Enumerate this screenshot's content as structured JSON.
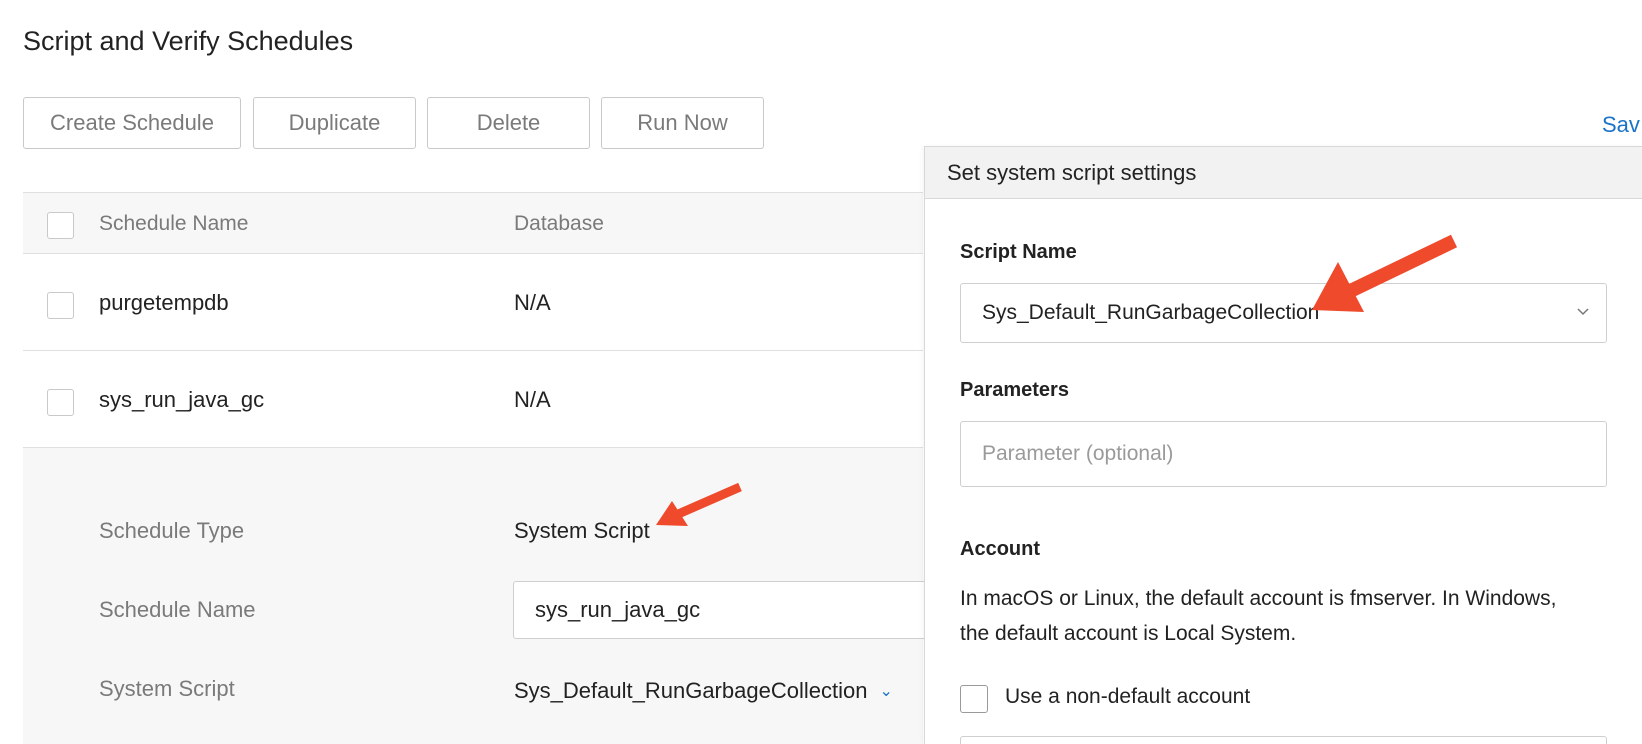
{
  "page": {
    "title": "Script and Verify Schedules"
  },
  "toolbar": {
    "create_label": "Create Schedule",
    "duplicate_label": "Duplicate",
    "delete_label": "Delete",
    "run_now_label": "Run Now",
    "save_label": "Sav"
  },
  "table": {
    "headers": {
      "name": "Schedule Name",
      "database": "Database"
    },
    "rows": [
      {
        "name": "purgetempdb",
        "database": "N/A"
      },
      {
        "name": "sys_run_java_gc",
        "database": "N/A"
      }
    ]
  },
  "details": {
    "type_label": "Schedule Type",
    "type_value": "System Script",
    "name_label": "Schedule Name",
    "name_value": "sys_run_java_gc",
    "script_label": "System Script",
    "script_value": "Sys_Default_RunGarbageCollection"
  },
  "panel": {
    "title": "Set system script settings",
    "script_name_label": "Script Name",
    "script_name_value": "Sys_Default_RunGarbageCollection",
    "parameters_label": "Parameters",
    "parameters_placeholder": "Parameter (optional)",
    "account_label": "Account",
    "account_description": "In macOS or Linux, the default account is fmserver. In Windows, the default account is Local System.",
    "non_default_label": "Use a non-default account"
  },
  "colors": {
    "accent": "#1a73c8",
    "annotation_arrow": "#ee4a2b"
  }
}
